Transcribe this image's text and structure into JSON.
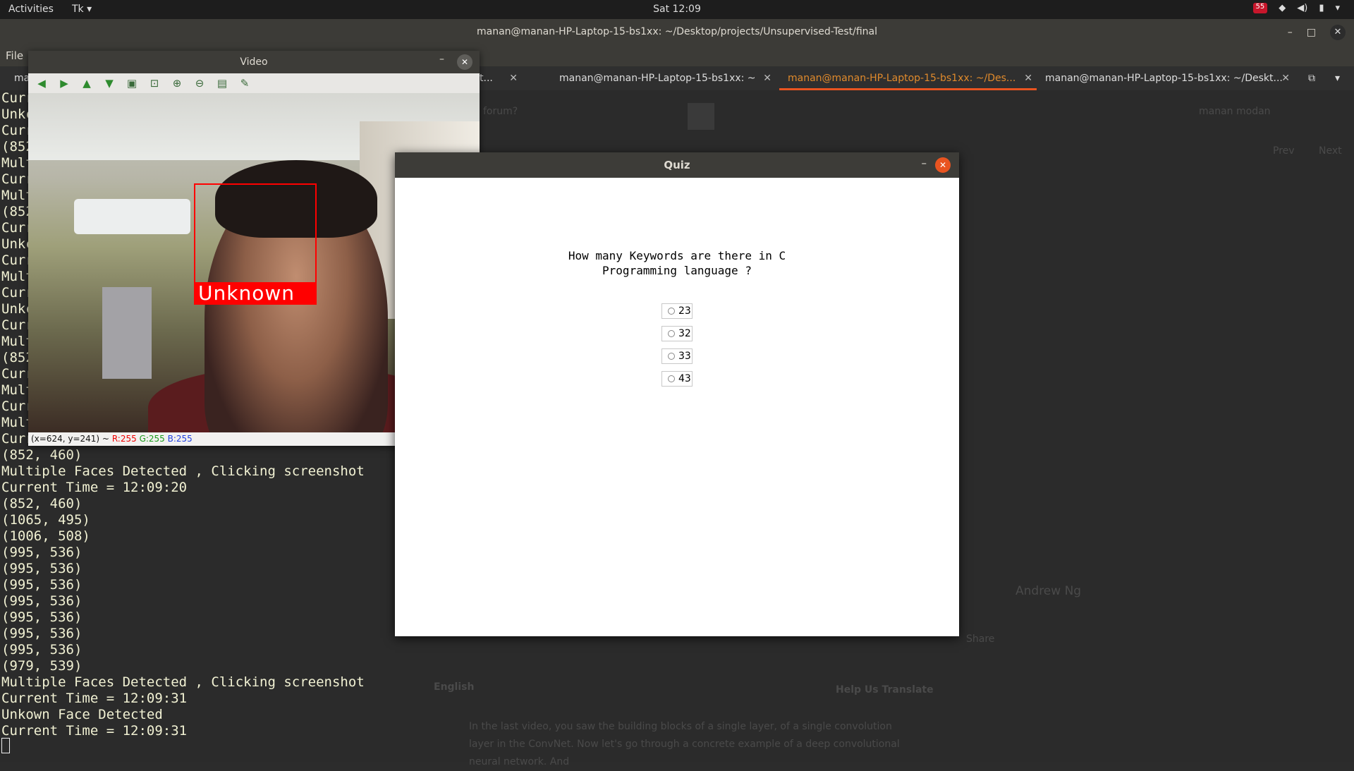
{
  "topbar": {
    "activities": "Activities",
    "app_menu": "Tk ▾",
    "clock": "Sat 12:09",
    "tray_badge": "55"
  },
  "terminal": {
    "title": "manan@manan-HP-Laptop-15-bs1xx: ~/Desktop/projects/Unsupervised-Test/final",
    "menu_file": "File",
    "tabs": [
      {
        "label": "ma"
      },
      {
        "label": "t..."
      },
      {
        "label": "manan@manan-HP-Laptop-15-bs1xx: ~"
      },
      {
        "label": "manan@manan-HP-Laptop-15-bs1xx: ~/Des..."
      },
      {
        "label": "manan@manan-HP-Laptop-15-bs1xx: ~/Deskt..."
      }
    ],
    "left_peek": [
      "Curr",
      "Unkc",
      "Curr",
      "(852",
      "Mult",
      "Curr",
      "Mult",
      "(852",
      "Curr",
      "Unkc",
      "Curr",
      "Mult",
      "Curr",
      "Unkc",
      "Curr",
      "Mult",
      "(852",
      "Curr",
      "Mult",
      "Curr",
      "Mult",
      "Curr"
    ],
    "lines": [
      "(852, 460)",
      "Multiple Faces Detected , Clicking screenshot",
      "Current Time = 12:09:20",
      "(852, 460)",
      "(1065, 495)",
      "(1006, 508)",
      "(995, 536)",
      "(995, 536)",
      "(995, 536)",
      "(995, 536)",
      "(995, 536)",
      "(995, 536)",
      "(995, 536)",
      "(979, 539)",
      "Multiple Faces Detected , Clicking screenshot",
      "Current Time = 12:09:31",
      "Unkown Face Detected",
      "Current Time = 12:09:31"
    ]
  },
  "background_browser": {
    "search_placeholder": "forum?",
    "user": "manan modan",
    "prev": "Prev",
    "next": "Next",
    "author": "Andrew Ng",
    "share": "Share",
    "language": "English",
    "help_translate": "Help Us Translate",
    "transcript": "In the last video, you saw the building blocks of a single layer, of a single convolution layer in the ConvNet. Now let's go through a concrete example of a deep convolutional neural network. And"
  },
  "video_window": {
    "title": "Video",
    "face_label": "Unknown",
    "status_coords": "(x=624, y=241) ~",
    "status_r": "R:255",
    "status_g": "G:255",
    "status_b": "B:255"
  },
  "quiz": {
    "title": "Quiz",
    "question": "How many Keywords are there in C\nProgramming language ?",
    "options": [
      "23",
      "32",
      "33",
      "43"
    ]
  }
}
